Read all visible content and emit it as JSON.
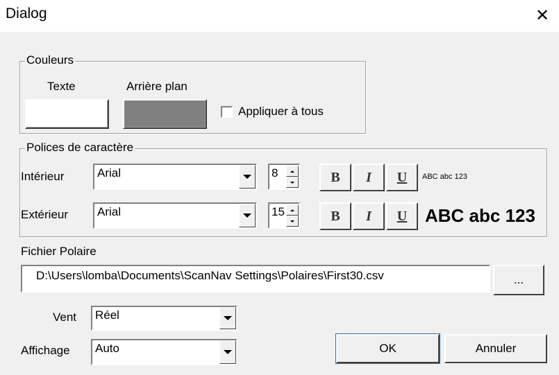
{
  "window": {
    "title": "Dialog",
    "close_glyph": "✕"
  },
  "couleurs": {
    "title": "Couleurs",
    "texte_label": "Texte",
    "arriere_label": "Arrière plan",
    "texte_color": "#ffffff",
    "arriere_color": "#808080",
    "apply_all_label": "Appliquer à tous",
    "apply_all_checked": false
  },
  "polices": {
    "title": "Polices de caractère",
    "rows": [
      {
        "label": "Intérieur",
        "font": "Arial",
        "size": "8",
        "bold": "B",
        "italic": "I",
        "underline": "U",
        "preview": "ABC abc 123"
      },
      {
        "label": "Extérieur",
        "font": "Arial",
        "size": "15",
        "bold": "B",
        "italic": "I",
        "underline": "U",
        "preview": "ABC abc 123"
      }
    ]
  },
  "polaire": {
    "label": "Fichier Polaire",
    "path": "D:\\Users\\lomba\\Documents\\ScanNav Settings\\Polaires\\First30.csv",
    "browse_label": "..."
  },
  "vent": {
    "label": "Vent",
    "value": "Réel"
  },
  "affichage": {
    "label": "Affichage",
    "value": "Auto"
  },
  "buttons": {
    "ok": "OK",
    "cancel": "Annuler"
  }
}
